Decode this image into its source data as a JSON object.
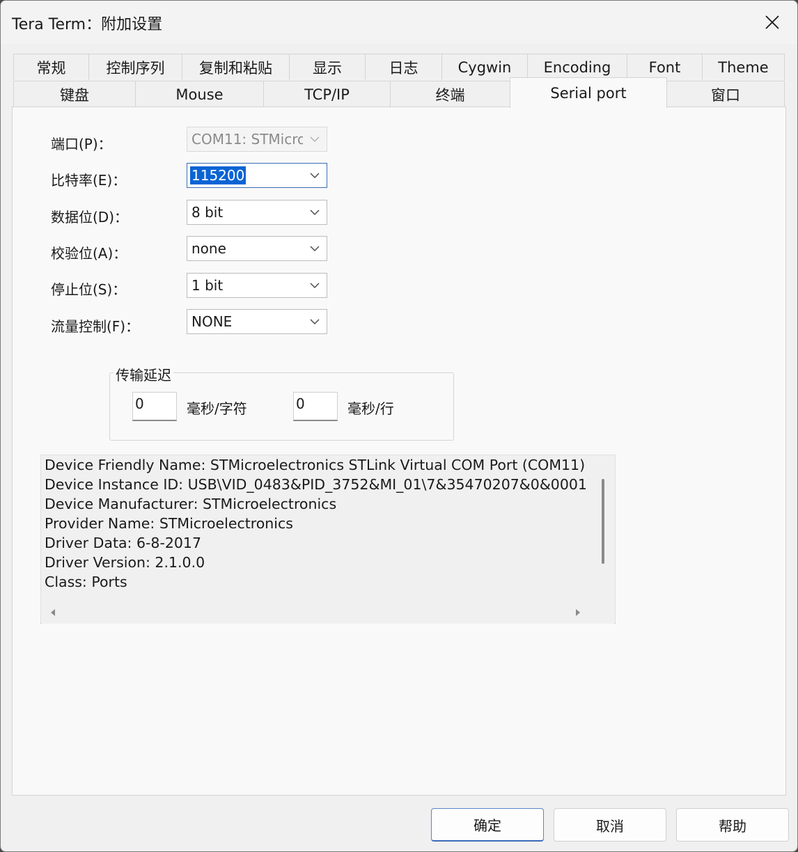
{
  "window": {
    "title": "Tera Term：附加设置"
  },
  "tabs_row1": [
    "常规",
    "控制序列",
    "复制和粘贴",
    "显示",
    "日志",
    "Cygwin",
    "Encoding",
    "Font",
    "Theme"
  ],
  "tabs_row2": [
    "键盘",
    "Mouse",
    "TCP/IP",
    "终端",
    "Serial port",
    "窗口"
  ],
  "active_tab": "Serial port",
  "fields": {
    "port": {
      "label": "端口(P)：",
      "value": "COM11: STMicro"
    },
    "baud": {
      "label": "比特率(E)：",
      "value": "115200"
    },
    "data_bits": {
      "label": "数据位(D)：",
      "value": "8 bit"
    },
    "parity": {
      "label": "校验位(A)：",
      "value": "none"
    },
    "stop_bits": {
      "label": "停止位(S)：",
      "value": "1 bit"
    },
    "flow_control": {
      "label": "流量控制(F)：",
      "value": "NONE"
    }
  },
  "delay_group": {
    "title": "传输延迟",
    "char_delay": "0",
    "char_unit": "毫秒/字符",
    "line_delay": "0",
    "line_unit": "毫秒/行"
  },
  "device_info": [
    "Device Friendly Name: STMicroelectronics STLink Virtual COM Port (COM11)",
    "Device Instance ID: USB\\VID_0483&PID_3752&MI_01\\7&35470207&0&0001",
    "Device Manufacturer: STMicroelectronics",
    "Provider Name: STMicroelectronics",
    "Driver Data: 6-8-2017",
    "Driver Version: 2.1.0.0",
    "Class: Ports"
  ],
  "buttons": {
    "ok": "确定",
    "cancel": "取消",
    "help": "帮助"
  }
}
